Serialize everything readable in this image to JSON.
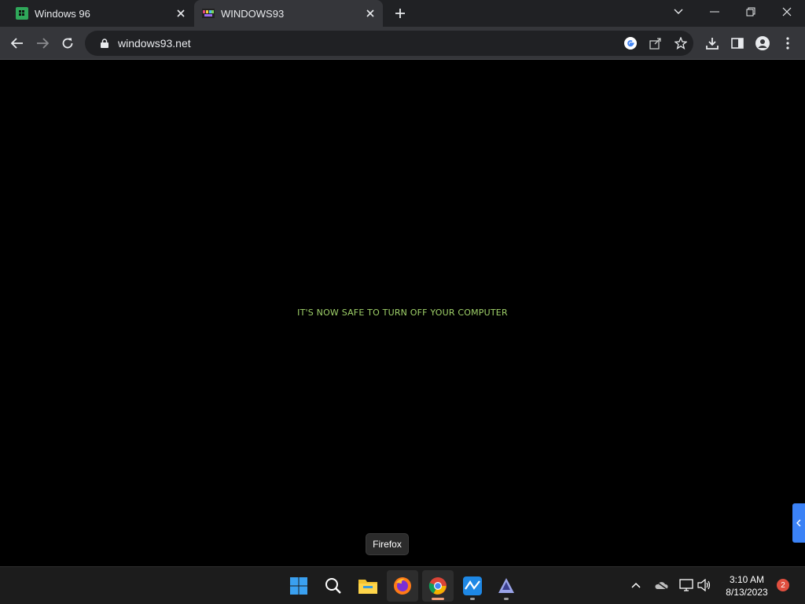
{
  "browser": {
    "tabs": [
      {
        "title": "Windows 96",
        "active": false,
        "favicon": "windows96-logo-icon"
      },
      {
        "title": "WINDOWS93",
        "active": true,
        "favicon": "windows93-logo-icon"
      }
    ],
    "address": {
      "url": "windows93.net"
    }
  },
  "page": {
    "message": "IT'S NOW SAFE TO TURN OFF YOUR COMPUTER",
    "message_color": "#9fd169",
    "background": "#000000"
  },
  "tooltip": {
    "text": "Firefox"
  },
  "taskbar": {
    "apps": [
      "start",
      "search",
      "file-explorer",
      "firefox",
      "chrome",
      "analytics-app",
      "inkscape-app"
    ],
    "clock": {
      "time": "3:10 AM",
      "date": "8/13/2023"
    },
    "notification_count": "2"
  }
}
